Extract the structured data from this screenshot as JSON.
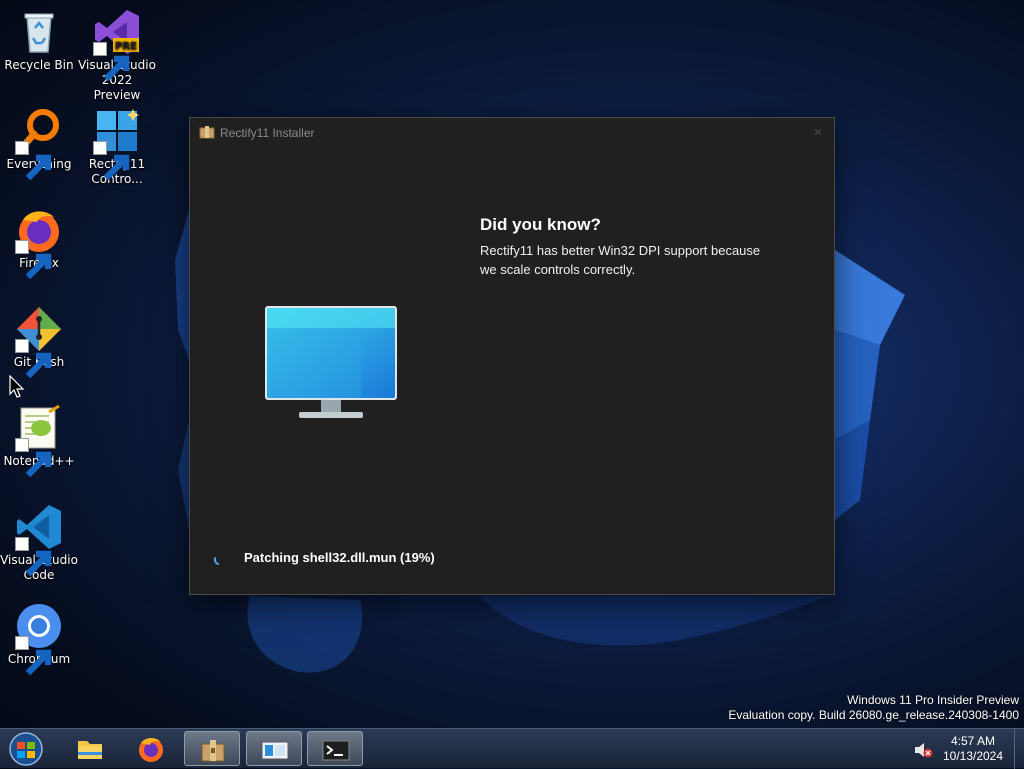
{
  "desktop": {
    "icons": [
      {
        "label": "Recycle Bin",
        "icon": "recycle-bin-icon"
      },
      {
        "label": "Visual Studio 2022 Preview",
        "icon": "visual-studio-preview-icon",
        "badge": "PRE"
      },
      {
        "label": "Everything",
        "icon": "everything-search-icon"
      },
      {
        "label": "Rectify11 Contro...",
        "icon": "rectify11-control-panel-icon"
      },
      {
        "label": "Firefox",
        "icon": "firefox-icon"
      },
      {
        "label": "Git Bash",
        "icon": "git-bash-icon"
      },
      {
        "label": "Notepad++",
        "icon": "notepad-plus-plus-icon"
      },
      {
        "label": "Visual Studio Code",
        "icon": "vscode-icon"
      },
      {
        "label": "Chromium",
        "icon": "chromium-icon"
      }
    ]
  },
  "installer": {
    "title": "Rectify11 Installer",
    "tip_heading": "Did you know?",
    "tip_body": "Rectify11 has better Win32 DPI support because we scale controls correctly.",
    "status": "Patching shell32.dll.mun (19%)",
    "progress_percent": 19
  },
  "watermark": {
    "line1": "Windows 11 Pro Insider Preview",
    "line2": "Evaluation copy. Build 26080.ge_release.240308-1400"
  },
  "taskbar": {
    "pinned": [
      "start-orb",
      "file-explorer",
      "firefox",
      "rectify11-installer",
      "rectify11-control-panel",
      "terminal"
    ],
    "clock_time": "4:57 AM",
    "clock_date": "10/13/2024"
  },
  "colors": {
    "window_bg": "#202020",
    "accent": "#1e90ff",
    "taskbar": "#1f2a40"
  }
}
